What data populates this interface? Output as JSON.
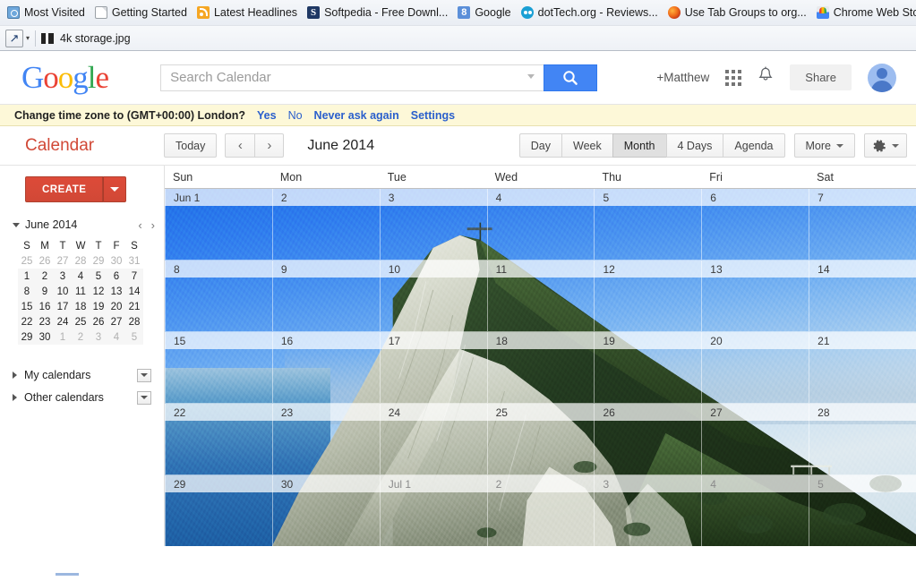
{
  "browser": {
    "bookmarks": [
      {
        "label": "Most Visited",
        "icon": "most-visited-icon"
      },
      {
        "label": "Getting Started",
        "icon": "page-icon"
      },
      {
        "label": "Latest Headlines",
        "icon": "rss-icon"
      },
      {
        "label": "Softpedia - Free Downl...",
        "icon": "softpedia-icon"
      },
      {
        "label": "Google",
        "icon": "google-plus-icon"
      },
      {
        "label": "dotTech.org - Reviews...",
        "icon": "dottech-icon"
      },
      {
        "label": "Use Tab Groups to org...",
        "icon": "firefox-icon"
      },
      {
        "label": "Chrome Web Store - P...",
        "icon": "chrome-web-store-icon"
      }
    ],
    "overflow_label": "»",
    "toolbar": {
      "back_icon": "back-arrow-icon",
      "caret": "▾",
      "file_icon": "pause-file-icon",
      "page_title": "4k storage.jpg"
    }
  },
  "header": {
    "logo": {
      "g1": "G",
      "o1": "o",
      "o2": "o",
      "g2": "g",
      "l": "l",
      "e": "e"
    },
    "search": {
      "value": "",
      "placeholder": "Search Calendar",
      "button_icon": "search-icon",
      "dropdown_icon": "chevron-down-icon"
    },
    "user_link": "+Matthew",
    "apps_icon": "apps-grid-icon",
    "bell_icon": "notifications-bell-icon",
    "share_label": "Share",
    "avatar_icon": "user-avatar"
  },
  "notice": {
    "message": "Change time zone to (GMT+00:00) London?",
    "yes": "Yes",
    "no": "No",
    "never": "Never ask again",
    "settings": "Settings"
  },
  "toolbar": {
    "brand": "Calendar",
    "today_label": "Today",
    "prev_icon": "chevron-left-icon",
    "next_icon": "chevron-right-icon",
    "prev_glyph": "‹",
    "next_glyph": "›",
    "period": "June 2014",
    "views": [
      {
        "label": "Day",
        "selected": false
      },
      {
        "label": "Week",
        "selected": false
      },
      {
        "label": "Month",
        "selected": true
      },
      {
        "label": "4 Days",
        "selected": false
      },
      {
        "label": "Agenda",
        "selected": false
      }
    ],
    "more_label": "More",
    "gear_icon": "gear-icon"
  },
  "sidebar": {
    "create_label": "CREATE",
    "create_caret_icon": "chevron-down-icon",
    "mini_title": "June 2014",
    "mini_prev": "‹",
    "mini_next": "›",
    "mini_weekdays": [
      "S",
      "M",
      "T",
      "W",
      "T",
      "F",
      "S"
    ],
    "mini_weeks": [
      [
        {
          "d": "25",
          "out": true
        },
        {
          "d": "26",
          "out": true
        },
        {
          "d": "27",
          "out": true
        },
        {
          "d": "28",
          "out": true
        },
        {
          "d": "29",
          "out": true
        },
        {
          "d": "30",
          "out": true
        },
        {
          "d": "31",
          "out": true
        }
      ],
      [
        {
          "d": "1",
          "out": false
        },
        {
          "d": "2",
          "out": false
        },
        {
          "d": "3",
          "out": false
        },
        {
          "d": "4",
          "out": false
        },
        {
          "d": "5",
          "out": false
        },
        {
          "d": "6",
          "out": false
        },
        {
          "d": "7",
          "out": false
        }
      ],
      [
        {
          "d": "8",
          "out": false
        },
        {
          "d": "9",
          "out": false
        },
        {
          "d": "10",
          "out": false
        },
        {
          "d": "11",
          "out": false
        },
        {
          "d": "12",
          "out": false
        },
        {
          "d": "13",
          "out": false
        },
        {
          "d": "14",
          "out": false
        }
      ],
      [
        {
          "d": "15",
          "out": false
        },
        {
          "d": "16",
          "out": false
        },
        {
          "d": "17",
          "out": false
        },
        {
          "d": "18",
          "out": false
        },
        {
          "d": "19",
          "out": false
        },
        {
          "d": "20",
          "out": false
        },
        {
          "d": "21",
          "out": false
        }
      ],
      [
        {
          "d": "22",
          "out": false
        },
        {
          "d": "23",
          "out": false
        },
        {
          "d": "24",
          "out": false
        },
        {
          "d": "25",
          "out": false
        },
        {
          "d": "26",
          "out": false
        },
        {
          "d": "27",
          "out": false
        },
        {
          "d": "28",
          "out": false
        }
      ],
      [
        {
          "d": "29",
          "out": false
        },
        {
          "d": "30",
          "out": false
        },
        {
          "d": "1",
          "out": true
        },
        {
          "d": "2",
          "out": true
        },
        {
          "d": "3",
          "out": true
        },
        {
          "d": "4",
          "out": true
        },
        {
          "d": "5",
          "out": true
        }
      ]
    ],
    "my_calendars_label": "My calendars",
    "other_calendars_label": "Other calendars",
    "expand_icon": "triangle-right-icon",
    "section_menu_icon": "chevron-down-icon"
  },
  "grid": {
    "weekdays": [
      "Sun",
      "Mon",
      "Tue",
      "Wed",
      "Thu",
      "Fri",
      "Sat"
    ],
    "weeks": [
      [
        {
          "d": "Jun 1",
          "other": false
        },
        {
          "d": "2",
          "other": false
        },
        {
          "d": "3",
          "other": false
        },
        {
          "d": "4",
          "other": false
        },
        {
          "d": "5",
          "other": false
        },
        {
          "d": "6",
          "other": false
        },
        {
          "d": "7",
          "other": false
        }
      ],
      [
        {
          "d": "8",
          "other": false
        },
        {
          "d": "9",
          "other": false
        },
        {
          "d": "10",
          "other": false
        },
        {
          "d": "11",
          "other": false
        },
        {
          "d": "12",
          "other": false
        },
        {
          "d": "13",
          "other": false
        },
        {
          "d": "14",
          "other": false
        }
      ],
      [
        {
          "d": "15",
          "other": false
        },
        {
          "d": "16",
          "other": false
        },
        {
          "d": "17",
          "other": false
        },
        {
          "d": "18",
          "other": false
        },
        {
          "d": "19",
          "other": false
        },
        {
          "d": "20",
          "other": false
        },
        {
          "d": "21",
          "other": false
        }
      ],
      [
        {
          "d": "22",
          "other": false
        },
        {
          "d": "23",
          "other": false
        },
        {
          "d": "24",
          "other": false
        },
        {
          "d": "25",
          "other": false
        },
        {
          "d": "26",
          "other": false
        },
        {
          "d": "27",
          "other": false
        },
        {
          "d": "28",
          "other": false
        }
      ],
      [
        {
          "d": "29",
          "other": false
        },
        {
          "d": "30",
          "other": false
        },
        {
          "d": "Jul 1",
          "other": true
        },
        {
          "d": "2",
          "other": true
        },
        {
          "d": "3",
          "other": true
        },
        {
          "d": "4",
          "other": true
        },
        {
          "d": "5",
          "other": true
        }
      ]
    ],
    "background_photo": "rock-of-gibraltar-photo"
  },
  "colors": {
    "google_blue": "#4285f4",
    "google_red": "#ea4335",
    "google_yellow": "#fbbc05",
    "google_green": "#34a853",
    "calendar_brand_red": "#d14836",
    "notice_background": "#fdf8d8",
    "link_blue": "#2a5fcc"
  }
}
